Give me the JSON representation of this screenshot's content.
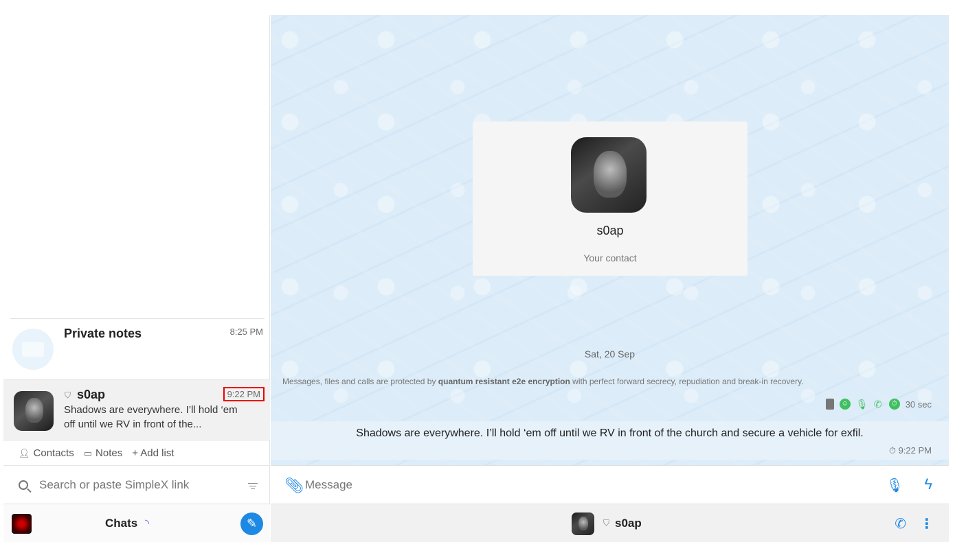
{
  "chat_list": [
    {
      "title": "Private notes",
      "time": "8:25 PM",
      "preview": ""
    },
    {
      "title": "s0ap",
      "time": "9:22 PM",
      "preview": "Shadows are everywhere. I’ll hold ‘em off until we RV in front of the..."
    }
  ],
  "tags": {
    "contacts": "Contacts",
    "notes": "Notes",
    "add_list": "+ Add list"
  },
  "search": {
    "placeholder": "Search or paste SimpleX link"
  },
  "bottom_bar": {
    "chats_label": "Chats"
  },
  "contact_card": {
    "name": "s0ap",
    "subtitle": "Your contact"
  },
  "conversation": {
    "date": "Sat, 20 Sep",
    "e2e_prefix": "Messages, files and calls are protected by ",
    "e2e_bold": "quantum resistant e2e encryption",
    "e2e_suffix": " with perfect forward secrecy, repudiation and break-in recovery.",
    "timer": "30 sec",
    "message": {
      "text": "Shadows are everywhere. I’ll hold ‘em off until we RV in front of the church and secure a vehicle for exfil.",
      "time": "9:22 PM"
    }
  },
  "composer": {
    "placeholder": "Message"
  },
  "header": {
    "name": "s0ap"
  },
  "colors": {
    "accent": "#1e88e5",
    "highlight_border": "#e00000",
    "pref_green": "#3fbf5f"
  }
}
